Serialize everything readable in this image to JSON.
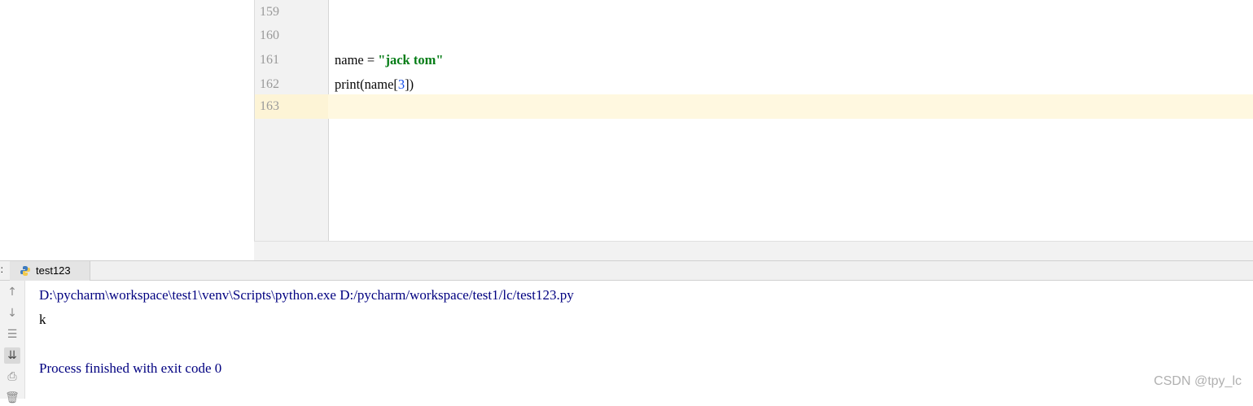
{
  "editor": {
    "lines": [
      {
        "num": "159",
        "text": ""
      },
      {
        "num": "160",
        "text": ""
      },
      {
        "num": "161",
        "text": "name = \"jack tom\""
      },
      {
        "num": "162",
        "text": "print(name[3])"
      },
      {
        "num": "163",
        "text": ""
      }
    ],
    "line161": {
      "prefix": "name = ",
      "string": "\"jack tom\""
    },
    "line162": {
      "prefix": "print(name[",
      "index": "3",
      "suffix": "])"
    }
  },
  "run": {
    "panel_label": "n:",
    "tab_label": "test123",
    "tab_icon": "python-icon"
  },
  "console": {
    "command": "D:\\pycharm\\workspace\\test1\\venv\\Scripts\\python.exe D:/pycharm/workspace/test1/lc/test123.py",
    "output": "k",
    "blank": "",
    "exit": "Process finished with exit code 0"
  },
  "toolbar_icons": [
    "up-arrow-icon",
    "down-arrow-icon",
    "soft-wrap-icon",
    "scroll-to-end-icon",
    "print-icon",
    "trash-icon"
  ],
  "watermark": "CSDN @tpy_lc"
}
